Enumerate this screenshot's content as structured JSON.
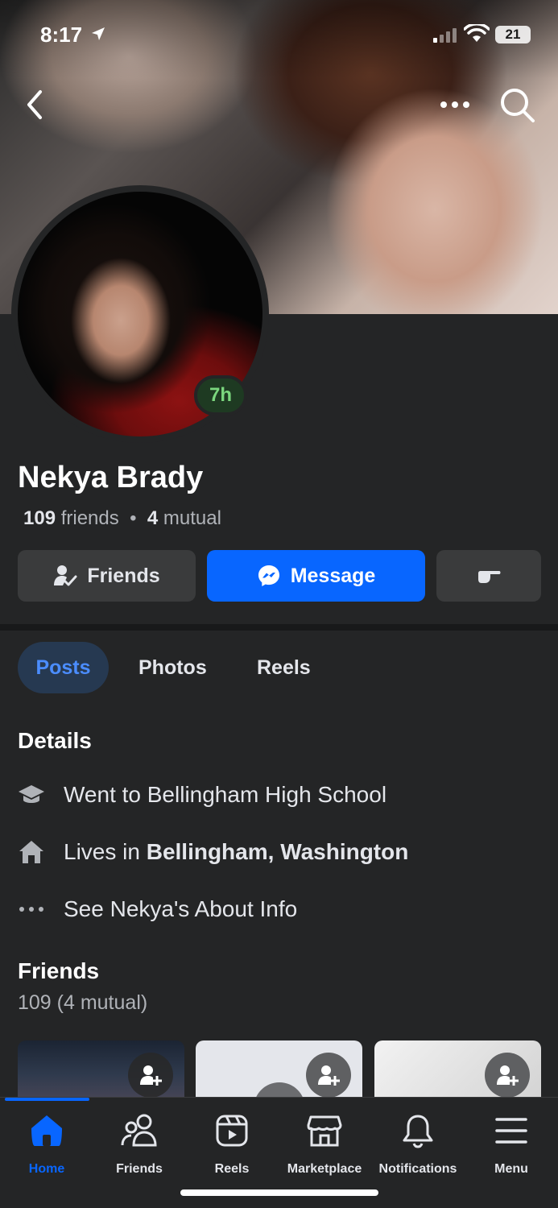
{
  "status_bar": {
    "time": "8:17",
    "battery": "21"
  },
  "profile": {
    "name": "Nekya Brady",
    "active_badge": "7h",
    "friends_count": "109",
    "friends_word": "friends",
    "separator": "•",
    "mutual_count": "4",
    "mutual_word": "mutual"
  },
  "actions": {
    "friends_label": "Friends",
    "message_label": "Message"
  },
  "tabs": [
    {
      "label": "Posts",
      "active": true
    },
    {
      "label": "Photos",
      "active": false
    },
    {
      "label": "Reels",
      "active": false
    }
  ],
  "details": {
    "title": "Details",
    "school": "Went to Bellingham High School",
    "lives_prefix": "Lives in ",
    "lives_place": "Bellingham, Washington",
    "about_link": "See Nekya's About Info"
  },
  "friends_section": {
    "title": "Friends",
    "subtitle": "109 (4 mutual)"
  },
  "bottom_nav": [
    {
      "label": "Home",
      "icon": "home-icon",
      "active": true
    },
    {
      "label": "Friends",
      "icon": "friends-icon",
      "active": false
    },
    {
      "label": "Reels",
      "icon": "reels-icon",
      "active": false
    },
    {
      "label": "Marketplace",
      "icon": "marketplace-icon",
      "active": false
    },
    {
      "label": "Notifications",
      "icon": "bell-icon",
      "active": false
    },
    {
      "label": "Menu",
      "icon": "menu-icon",
      "active": false
    }
  ],
  "colors": {
    "accent": "#0866ff",
    "background": "#242526",
    "active_badge": "#7bd67e"
  }
}
